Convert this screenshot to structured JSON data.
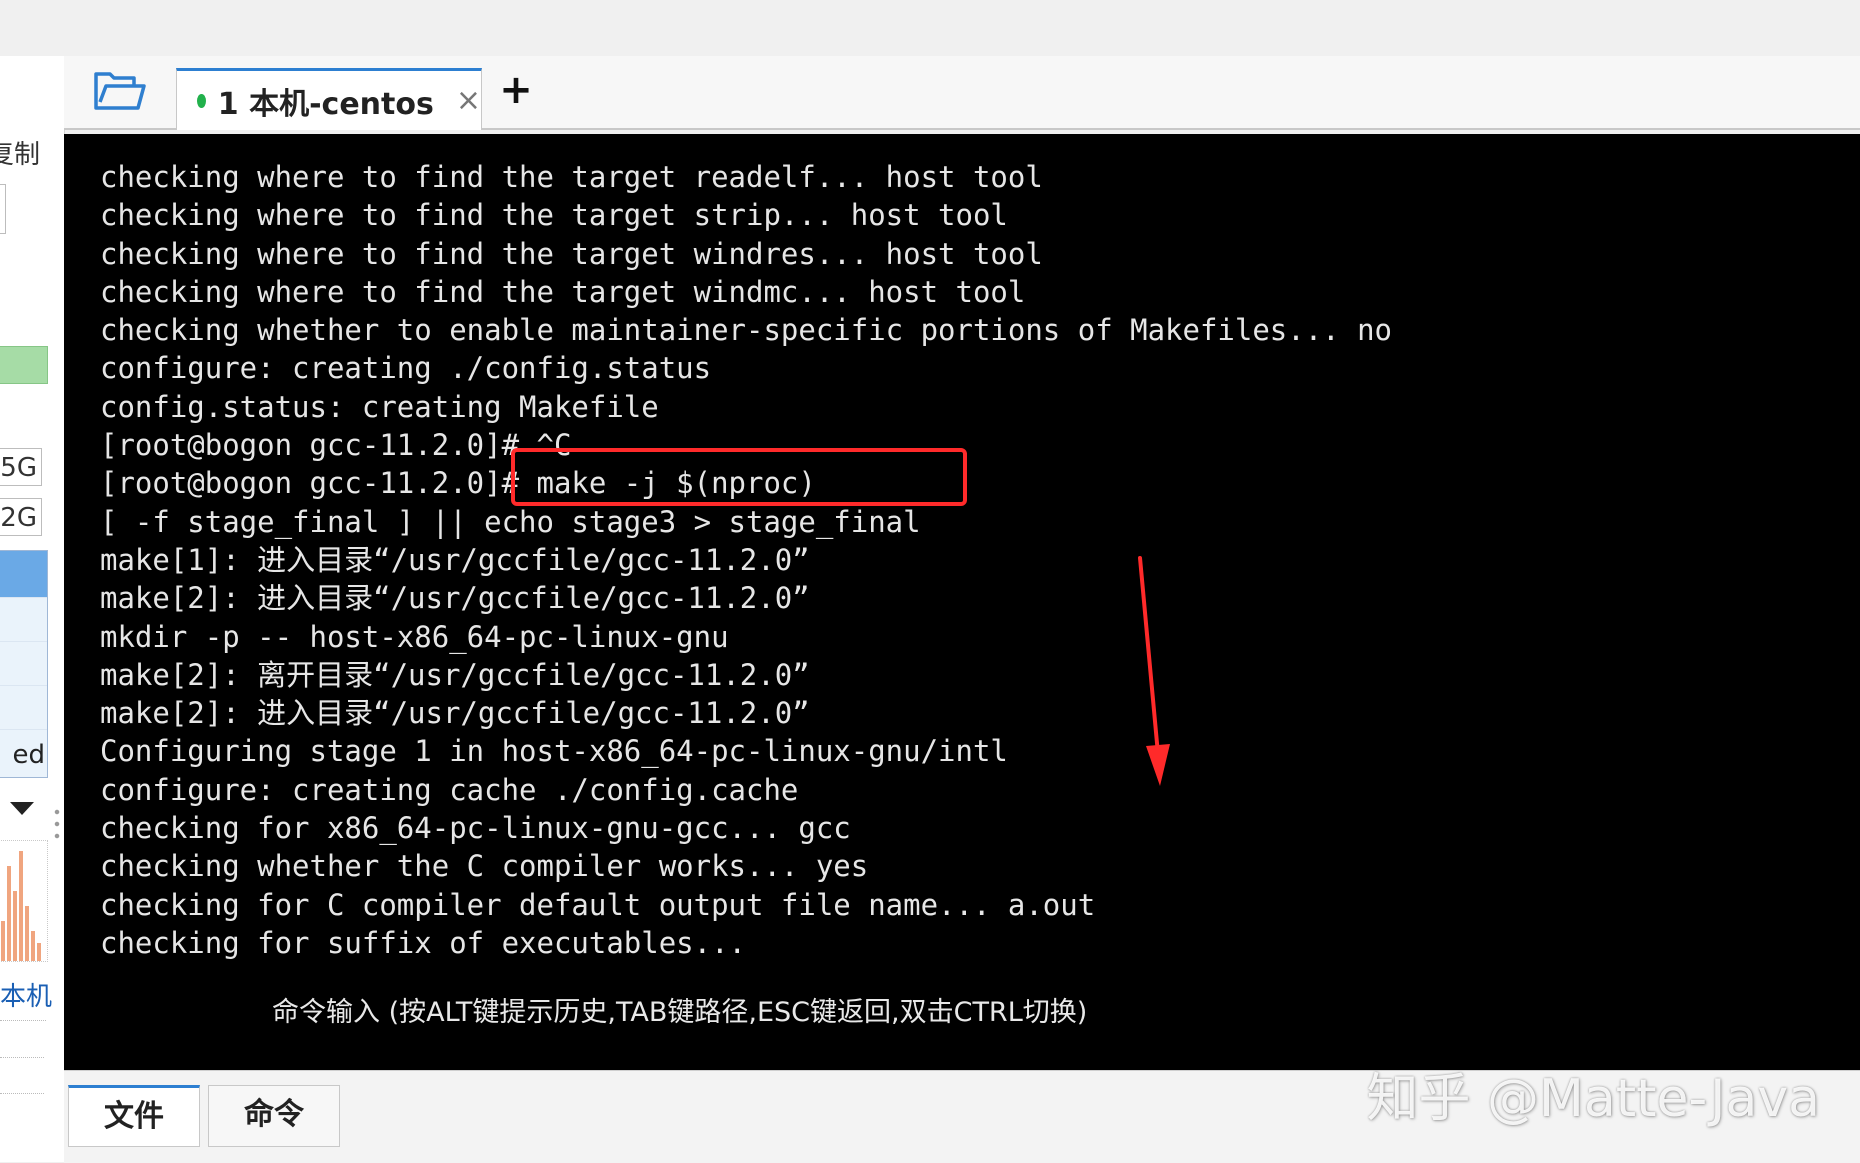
{
  "sidebar": {
    "copy_label": "复制",
    "size_a": "5G",
    "size_b": "2G",
    "list_tail": "ed",
    "local_label": "本机"
  },
  "tabs": {
    "session_tab": {
      "label": "1 本机-centos",
      "status_color": "#22b14c",
      "close_glyph": "×"
    },
    "add_glyph": "+"
  },
  "terminal": {
    "lines": [
      "checking where to find the target readelf... host tool",
      "checking where to find the target strip... host tool",
      "checking where to find the target windres... host tool",
      "checking where to find the target windmc... host tool",
      "checking whether to enable maintainer-specific portions of Makefiles... no",
      "configure: creating ./config.status",
      "config.status: creating Makefile",
      "[root@bogon gcc-11.2.0]# ^C",
      "[root@bogon gcc-11.2.0]# make -j $(nproc)",
      "[ -f stage_final ] || echo stage3 > stage_final",
      "make[1]: 进入目录“/usr/gccfile/gcc-11.2.0”",
      "make[2]: 进入目录“/usr/gccfile/gcc-11.2.0”",
      "mkdir -p -- host-x86_64-pc-linux-gnu",
      "make[2]: 离开目录“/usr/gccfile/gcc-11.2.0”",
      "make[2]: 进入目录“/usr/gccfile/gcc-11.2.0”",
      "Configuring stage 1 in host-x86_64-pc-linux-gnu/intl",
      "configure: creating cache ./config.cache",
      "checking for x86_64-pc-linux-gnu-gcc... gcc",
      "checking whether the C compiler works... yes",
      "checking for C compiler default output file name... a.out",
      "checking for suffix of executables..."
    ],
    "command_hint": "命令输入 (按ALT键提示历史,TAB键路径,ESC键返回,双击CTRL切换)",
    "highlight_color": "#ff2a2a"
  },
  "bottom_tabs": {
    "files_label": "文件",
    "commands_label": "命令"
  },
  "watermark": "知乎 @Matte-Java"
}
